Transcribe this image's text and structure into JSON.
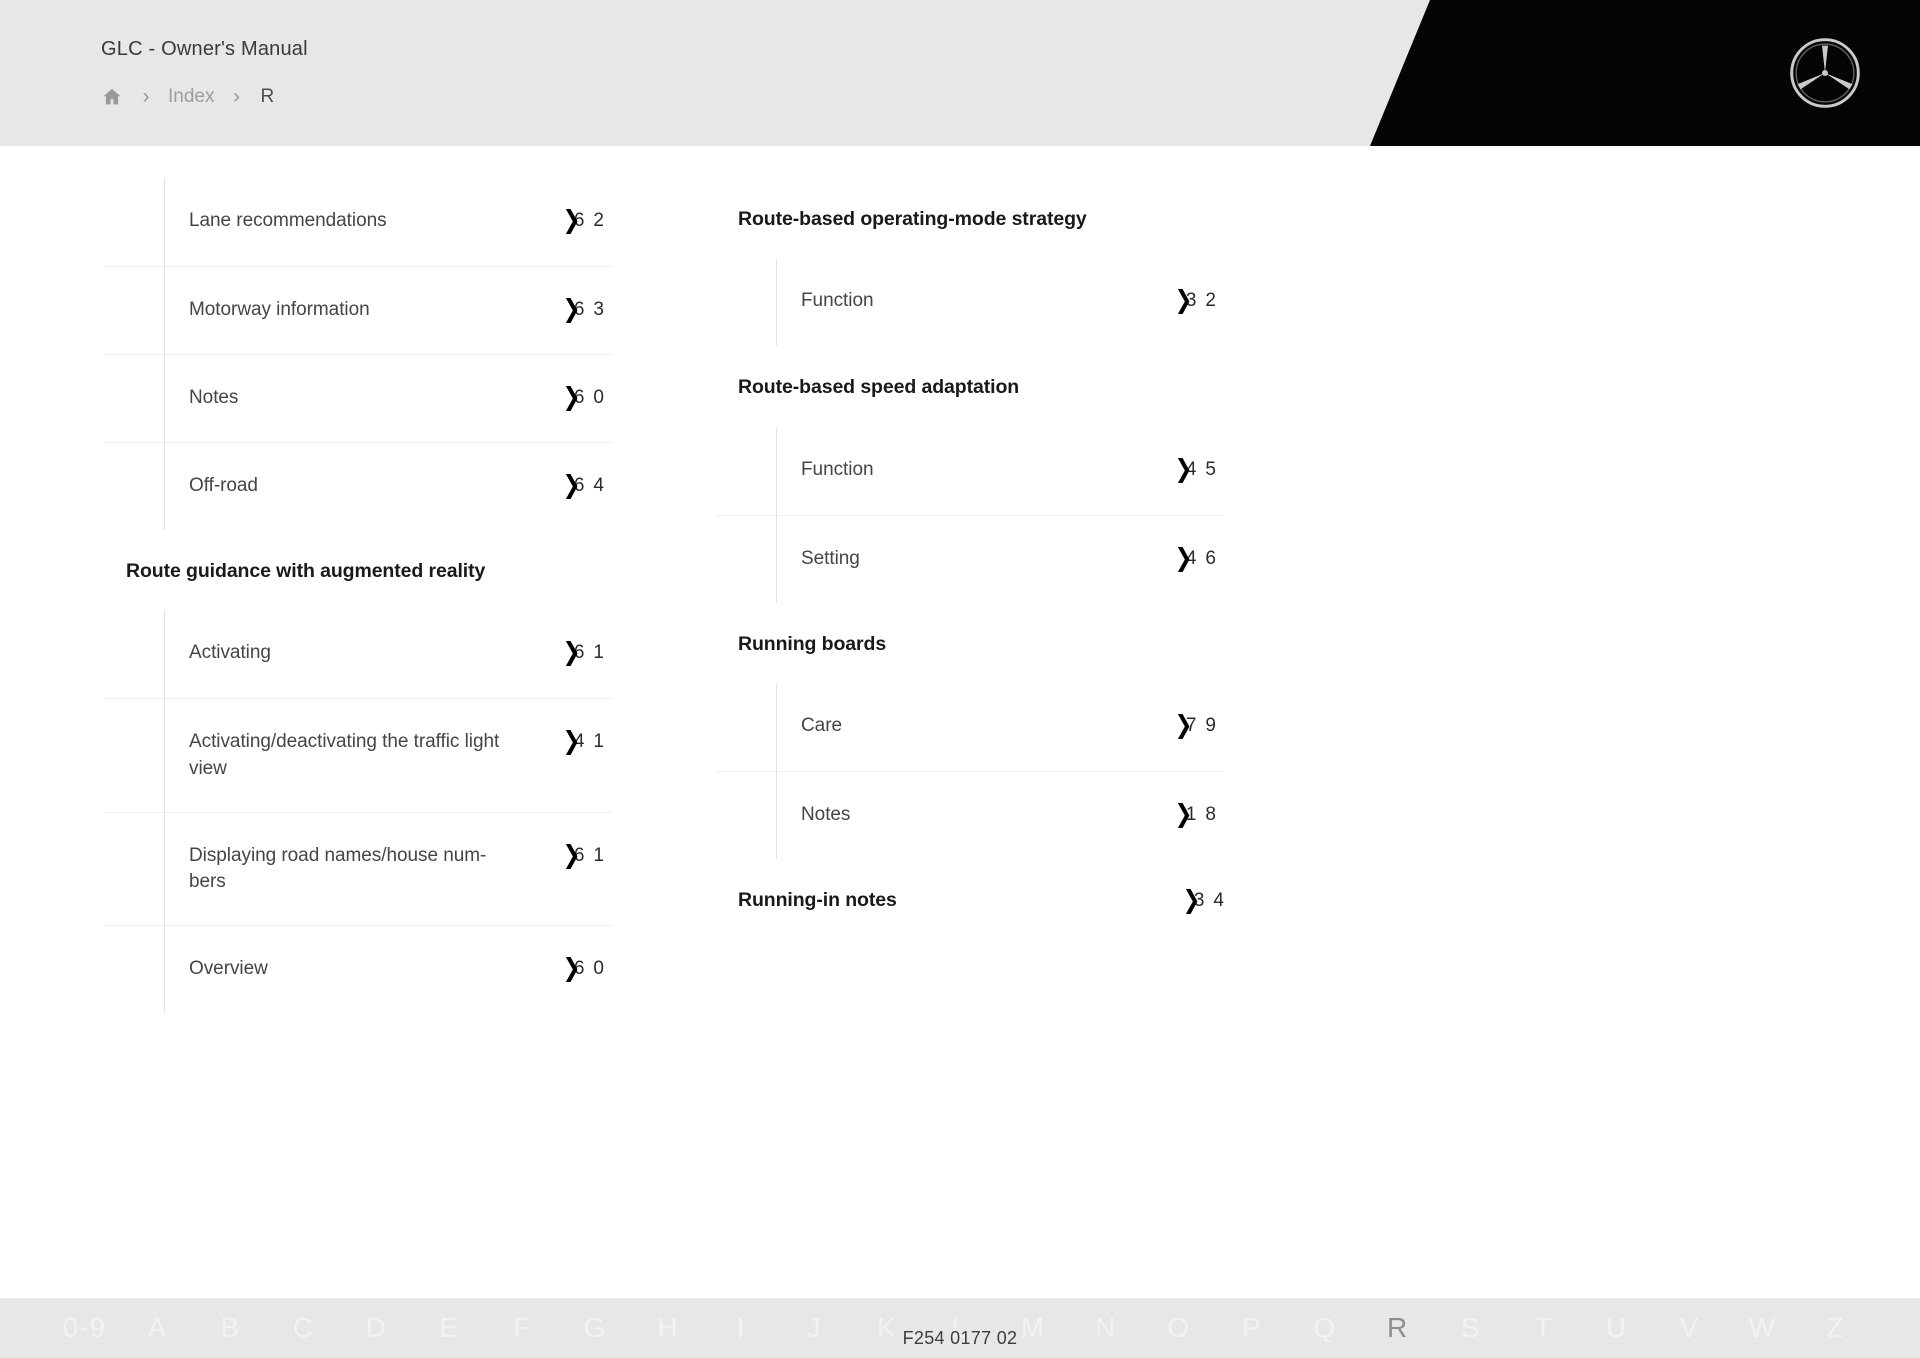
{
  "header": {
    "manual_title": "GLC - Owner's Manual",
    "breadcrumb": {
      "home_icon": "home-icon",
      "separator": "›",
      "index_label": "Index",
      "current_label": "R"
    },
    "brand_logo": "mercedes-benz-star-icon",
    "bg_color": "#e7e7e7",
    "panel_color": "#050505"
  },
  "index": {
    "columns": [
      {
        "groups": [
          {
            "heading": null,
            "entries": [
              {
                "label": "Lane recommendations",
                "page_left": "6",
                "page_arrow": "❯",
                "page_right": "2"
              },
              {
                "label": "Motorway information",
                "page_left": "6",
                "page_arrow": "❯",
                "page_right": "3"
              },
              {
                "label": "Notes",
                "page_left": "6",
                "page_arrow": "❯",
                "page_right": "0"
              },
              {
                "label": "Off-road",
                "page_left": "6",
                "page_arrow": "❯",
                "page_right": "4"
              }
            ]
          },
          {
            "heading": "Route guidance with augmented reality",
            "heading_page": null,
            "entries": [
              {
                "label": "Activating",
                "page_left": "6",
                "page_arrow": "❯",
                "page_right": "1"
              },
              {
                "label": "Activating/deactivating the traffic light view",
                "page_left": "4",
                "page_arrow": "❯",
                "page_right": "1"
              },
              {
                "label": "Displaying road names/house num-bers",
                "page_left": "6",
                "page_arrow": "❯",
                "page_right": "1"
              },
              {
                "label": "Overview",
                "page_left": "6",
                "page_arrow": "❯",
                "page_right": "0"
              }
            ]
          }
        ]
      },
      {
        "groups": [
          {
            "heading": "Route-based operating-mode strategy",
            "heading_page": null,
            "entries": [
              {
                "label": "Function",
                "page_left": "3",
                "page_arrow": "❯",
                "page_right": "2"
              }
            ]
          },
          {
            "heading": "Route-based speed adaptation",
            "heading_page": null,
            "entries": [
              {
                "label": "Function",
                "page_left": "4",
                "page_arrow": "❯",
                "page_right": "5"
              },
              {
                "label": "Setting",
                "page_left": "4",
                "page_arrow": "❯",
                "page_right": "6"
              }
            ]
          },
          {
            "heading": "Running boards",
            "heading_page": null,
            "entries": [
              {
                "label": "Care",
                "page_left": "7",
                "page_arrow": "❯",
                "page_right": "9"
              },
              {
                "label": "Notes",
                "page_left": "1",
                "page_arrow": "❯",
                "page_right": "8"
              }
            ]
          },
          {
            "heading": "Running-in notes",
            "heading_page": {
              "page_left": "3",
              "page_arrow": "❯",
              "page_right": "4"
            },
            "entries": []
          }
        ]
      }
    ]
  },
  "alphabet_bar": {
    "active_letter": "R",
    "letters": [
      "0-9",
      "A",
      "B",
      "C",
      "D",
      "E",
      "F",
      "G",
      "H",
      "I",
      "J",
      "K",
      "L",
      "M",
      "N",
      "O",
      "P",
      "Q",
      "R",
      "S",
      "T",
      "U",
      "V",
      "W",
      "Z"
    ],
    "bg_color": "#e7e7e7",
    "letter_color": "#f2f2f2",
    "active_color": "#8e8e8e"
  },
  "footer": {
    "document_code": "F254 0177 02"
  }
}
